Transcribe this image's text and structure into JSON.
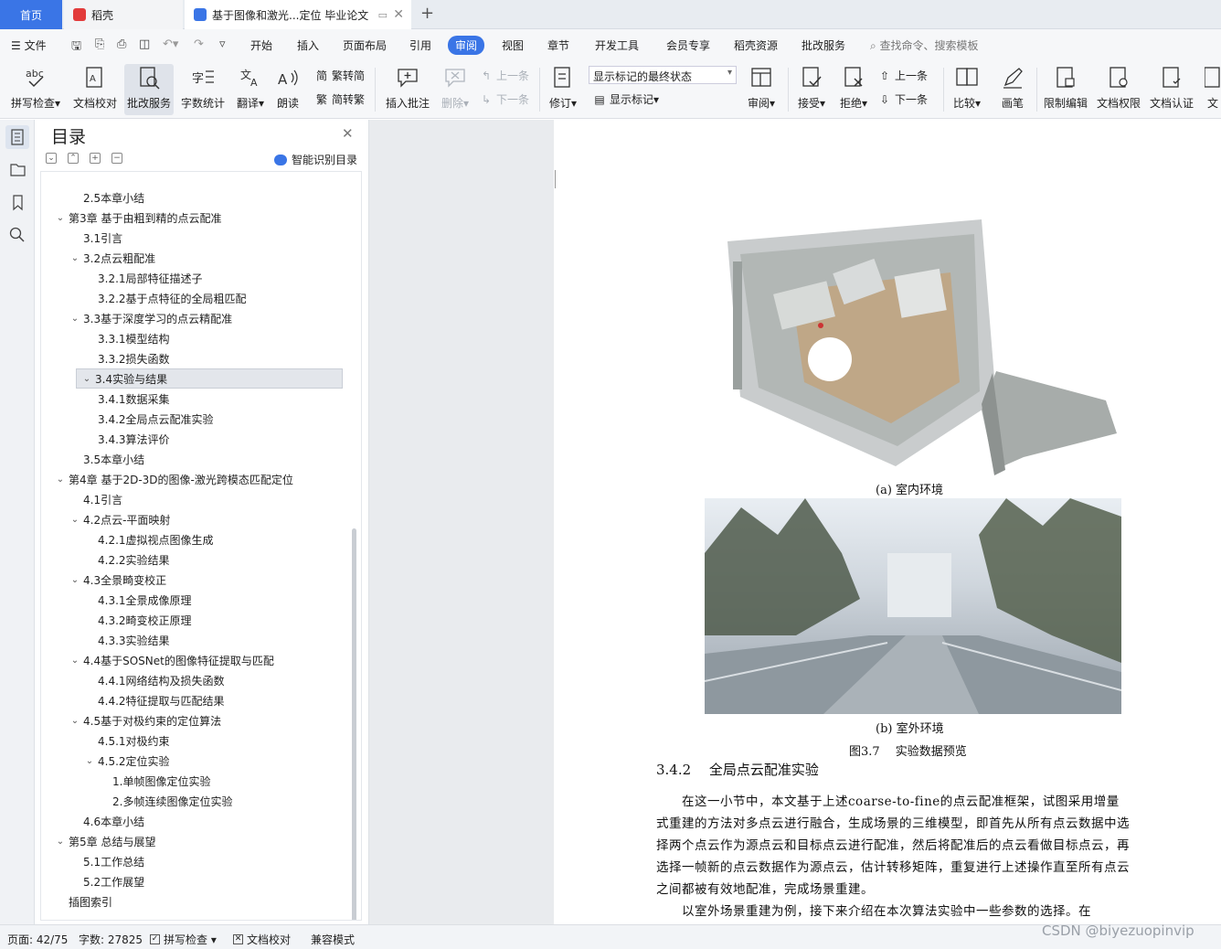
{
  "tabs": {
    "home": "首页",
    "daoke": "稻壳",
    "document": "基于图像和激光...定位 毕业论文",
    "add": "+"
  },
  "menu": {
    "file": "文件",
    "items": [
      "开始",
      "插入",
      "页面布局",
      "引用",
      "审阅",
      "视图",
      "章节",
      "开发工具",
      "会员专享",
      "稻壳资源",
      "批改服务"
    ],
    "search": "查找命令、搜索模板"
  },
  "ribbon": {
    "spell_check": "拼写检查",
    "proofread": "文档校对",
    "correction_service": "批改服务",
    "word_count": "字数统计",
    "translate": "翻译",
    "read_aloud": "朗读",
    "trad_to_simp": "繁转简",
    "simp_to_trad": "简转繁",
    "insert_comment": "插入批注",
    "delete": "删除",
    "prev_comment": "上一条",
    "next_comment": "下一条",
    "revise": "修订",
    "markup_state": "显示标记的最终状态",
    "show_markup": "显示标记",
    "review": "审阅",
    "accept": "接受",
    "reject": "拒绝",
    "prev_change": "上一条",
    "next_change": "下一条",
    "compare": "比较",
    "pen": "画笔",
    "restrict_edit": "限制编辑",
    "doc_permission": "文档权限",
    "doc_cert": "文档认证",
    "more": "文"
  },
  "toc": {
    "title": "目录",
    "smart": "智能识别目录",
    "items": [
      {
        "label": "2.5本章小结",
        "level": 2,
        "chev": ""
      },
      {
        "label": "第3章 基于由粗到精的点云配准",
        "level": 1,
        "chev": "v"
      },
      {
        "label": "3.1引言",
        "level": 2,
        "chev": ""
      },
      {
        "label": "3.2点云粗配准",
        "level": 2,
        "chev": "v"
      },
      {
        "label": "3.2.1局部特征描述子",
        "level": 3,
        "chev": ""
      },
      {
        "label": "3.2.2基于点特征的全局粗匹配",
        "level": 3,
        "chev": ""
      },
      {
        "label": "3.3基于深度学习的点云精配准",
        "level": 2,
        "chev": "v"
      },
      {
        "label": "3.3.1模型结构",
        "level": 3,
        "chev": ""
      },
      {
        "label": "3.3.2损失函数",
        "level": 3,
        "chev": ""
      },
      {
        "label": "3.4实验与结果",
        "level": 2,
        "chev": "v",
        "selected": true
      },
      {
        "label": "3.4.1数据采集",
        "level": 3,
        "chev": ""
      },
      {
        "label": "3.4.2全局点云配准实验",
        "level": 3,
        "chev": ""
      },
      {
        "label": "3.4.3算法评价",
        "level": 3,
        "chev": ""
      },
      {
        "label": "3.5本章小结",
        "level": 2,
        "chev": ""
      },
      {
        "label": "第4章 基于2D-3D的图像-激光跨模态匹配定位",
        "level": 1,
        "chev": "v"
      },
      {
        "label": "4.1引言",
        "level": 2,
        "chev": ""
      },
      {
        "label": "4.2点云-平面映射",
        "level": 2,
        "chev": "v"
      },
      {
        "label": "4.2.1虚拟视点图像生成",
        "level": 3,
        "chev": ""
      },
      {
        "label": "4.2.2实验结果",
        "level": 3,
        "chev": ""
      },
      {
        "label": "4.3全景畸变校正",
        "level": 2,
        "chev": "v"
      },
      {
        "label": "4.3.1全景成像原理",
        "level": 3,
        "chev": ""
      },
      {
        "label": "4.3.2畸变校正原理",
        "level": 3,
        "chev": ""
      },
      {
        "label": "4.3.3实验结果",
        "level": 3,
        "chev": ""
      },
      {
        "label": "4.4基于SOSNet的图像特征提取与匹配",
        "level": 2,
        "chev": "v"
      },
      {
        "label": "4.4.1网络结构及损失函数",
        "level": 3,
        "chev": ""
      },
      {
        "label": "4.4.2特征提取与匹配结果",
        "level": 3,
        "chev": ""
      },
      {
        "label": "4.5基于对极约束的定位算法",
        "level": 2,
        "chev": "v"
      },
      {
        "label": "4.5.1对极约束",
        "level": 3,
        "chev": ""
      },
      {
        "label": "4.5.2定位实验",
        "level": 3,
        "chev": "v"
      },
      {
        "label": "1.单帧图像定位实验",
        "level": 4,
        "chev": ""
      },
      {
        "label": "2.多帧连续图像定位实验",
        "level": 4,
        "chev": ""
      },
      {
        "label": "4.6本章小结",
        "level": 2,
        "chev": ""
      },
      {
        "label": "第5章 总结与展望",
        "level": 1,
        "chev": "v"
      },
      {
        "label": "5.1工作总结",
        "level": 2,
        "chev": ""
      },
      {
        "label": "5.2工作展望",
        "level": 2,
        "chev": ""
      },
      {
        "label": "插图索引",
        "level": 1,
        "chev": ""
      }
    ]
  },
  "document": {
    "caption_a": "(a) 室内环境",
    "caption_b": "(b) 室外环境",
    "figure_caption": "图3.7　 实验数据预览",
    "heading": "3.4.2　 全局点云配准实验",
    "para_lines": [
      "　　在这一小节中，本文基于上述coarse-to-fine的点云配准框架，试图采用增量",
      "式重建的方法对多点云进行融合，生成场景的三维模型，即首先从所有点云数据中选",
      "择两个点云作为源点云和目标点云进行配准，然后将配准后的点云看做目标点云，再",
      "选择一帧新的点云数据作为源点云，估计转移矩阵，重复进行上述操作直至所有点云",
      "之间都被有效地配准，完成场景重建。",
      "　　以室外场景重建为例，接下来介绍在本次算法实验中一些参数的选择。在"
    ]
  },
  "status": {
    "page": "页面: 42/75",
    "words": "字数: 27825",
    "spell_check": "拼写检查",
    "proofread": "文档校对",
    "compat": "兼容模式"
  },
  "watermark": "CSDN @biyezuopinvip",
  "colors": {
    "accent": "#3a75e6"
  }
}
